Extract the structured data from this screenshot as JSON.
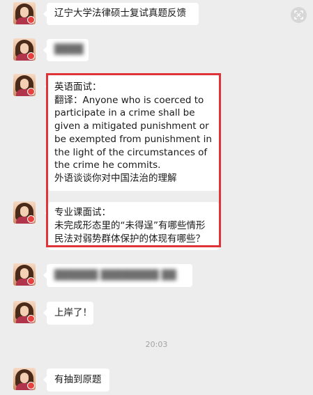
{
  "messages": [
    {
      "text": "辽宁大学法律硕士复试真题反馈"
    },
    {
      "text": "████"
    },
    {
      "lines": [
        "英语面试：",
        "翻译：Anyone who is coerced to",
        "participate in a crime shall be",
        "given a mitigated punishment or",
        "be exempted from punishment in",
        "the light of the circumstances of",
        "the crime he commits.",
        "外语谈谈你对中国法治的理解"
      ]
    },
    {
      "lines": [
        "专业课面试：",
        "未完成形态里的“未得逞”有哪些情形",
        "民法对弱势群体保护的体现有哪些？"
      ]
    },
    {
      "text": "██████ ████████ ██"
    },
    {
      "text": "上岸了！"
    },
    {
      "text": "有抽到原题"
    }
  ],
  "timestamp": "20:03",
  "icons": {
    "scan": "scan-text-icon",
    "avatar": "user-avatar"
  },
  "colors": {
    "background": "#ededed",
    "bubble": "#ffffff",
    "highlight": "#e03239"
  }
}
